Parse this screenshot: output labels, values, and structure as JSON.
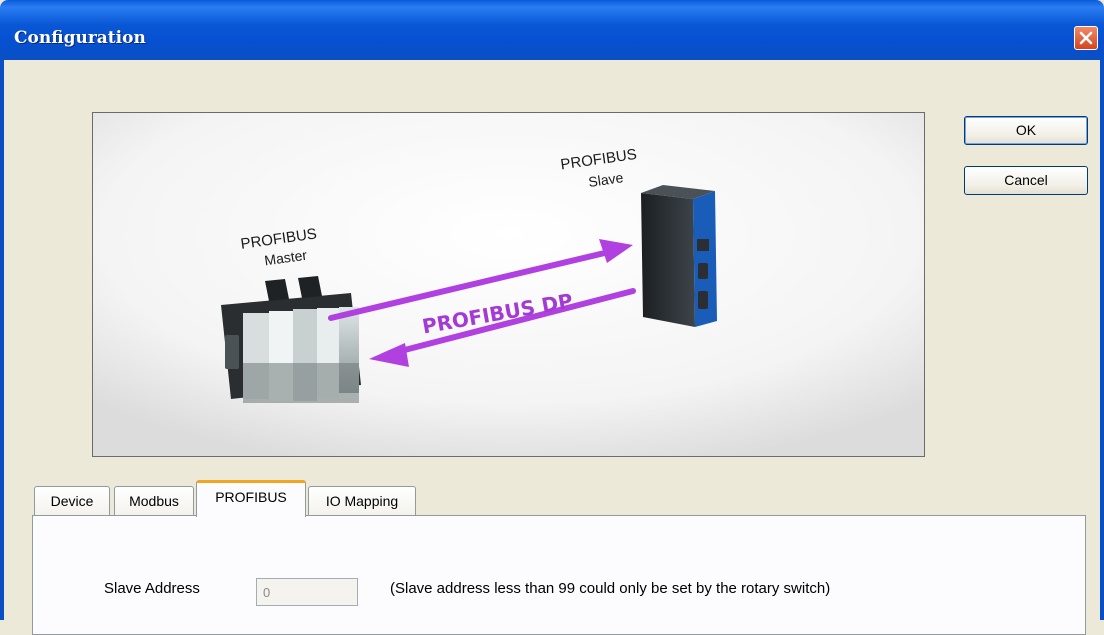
{
  "window": {
    "title": "Configuration"
  },
  "buttons": {
    "ok": "OK",
    "cancel": "Cancel"
  },
  "diagram": {
    "master_line1": "PROFIBUS",
    "master_line2": "Master",
    "slave_line1": "PROFIBUS",
    "slave_line2": "Slave",
    "protocol": "PROFIBUS DP",
    "arrow_color": "#b040e0"
  },
  "tabs": [
    {
      "label": "Device"
    },
    {
      "label": "Modbus"
    },
    {
      "label": "PROFIBUS"
    },
    {
      "label": "IO Mapping"
    }
  ],
  "active_tab": "PROFIBUS",
  "profibus": {
    "slave_address_label": "Slave Address",
    "slave_address_value": "0",
    "slave_address_note": "(Slave address less than 99 could only be set by the rotary switch)"
  }
}
